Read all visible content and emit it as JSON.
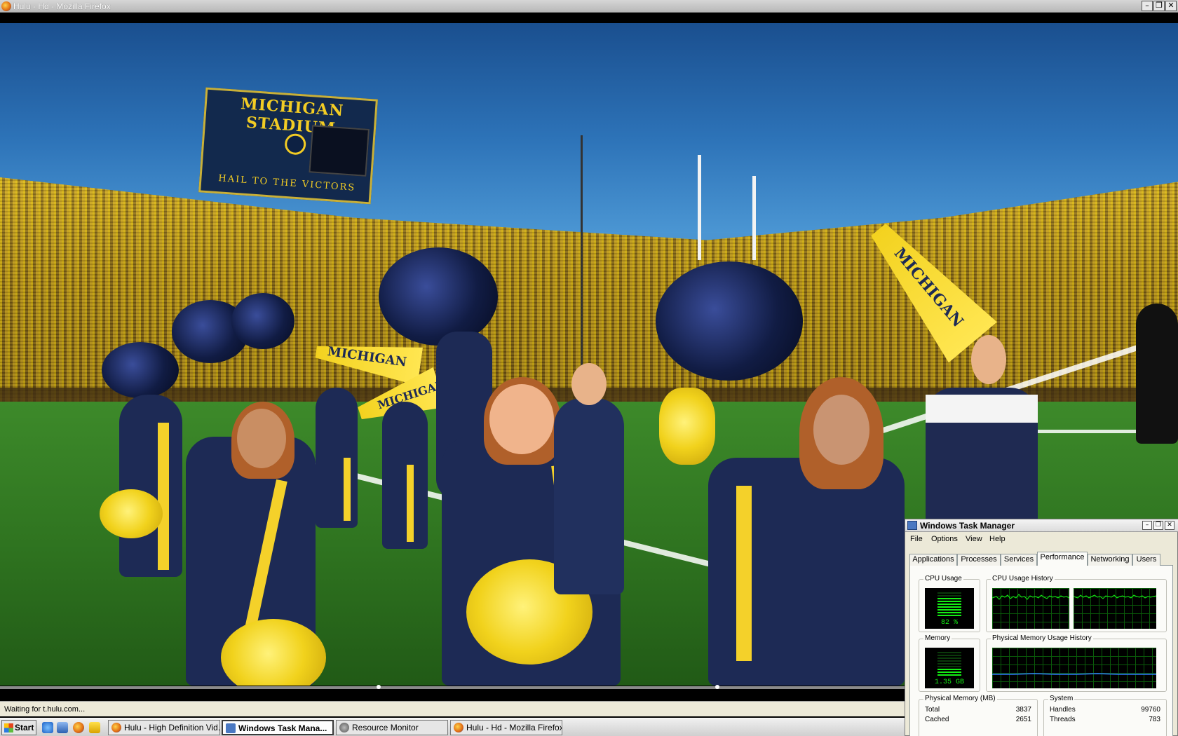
{
  "window": {
    "title": "Hulu - Hd - Mozilla Firefox",
    "controls": [
      "minimize",
      "restore",
      "close"
    ]
  },
  "video": {
    "scoreboard_title": "MICHIGAN STADIUM",
    "scoreboard_footer": "HAIL TO THE VICTORS",
    "megaphone_text": "MICHIGAN",
    "seek_markers": 2
  },
  "statusbar": {
    "text": "Waiting for t.hulu.com..."
  },
  "taskbar": {
    "start_label": "Start",
    "quicklaunch": [
      "internet-explorer-icon",
      "show-desktop-icon",
      "firefox-icon",
      "aim-icon"
    ],
    "tasks": [
      {
        "label": "Hulu - High Definition Vid...",
        "icon": "firefox-icon",
        "active": false
      },
      {
        "label": "Windows Task Mana...",
        "icon": "task-manager-icon",
        "active": true
      },
      {
        "label": "Resource Monitor",
        "icon": "resource-monitor-icon",
        "active": false
      },
      {
        "label": "Hulu - Hd - Mozilla Firefox",
        "icon": "firefox-icon",
        "active": false
      }
    ]
  },
  "taskmgr": {
    "title": "Windows Task Manager",
    "menu": [
      "File",
      "Options",
      "View",
      "Help"
    ],
    "tabs": [
      "Applications",
      "Processes",
      "Services",
      "Performance",
      "Networking",
      "Users"
    ],
    "active_tab": "Performance",
    "cpu_usage": {
      "label": "CPU Usage",
      "value": "82 %",
      "fraction": 0.82
    },
    "cpu_history": {
      "label": "CPU Usage History"
    },
    "memory": {
      "label": "Memory",
      "value": "1.35 GB",
      "fraction": 0.35
    },
    "mem_history": {
      "label": "Physical Memory Usage History"
    },
    "physical_memory": {
      "label": "Physical Memory (MB)",
      "rows": [
        {
          "name": "Total",
          "value": "3837"
        },
        {
          "name": "Cached",
          "value": "2651"
        }
      ]
    },
    "system": {
      "label": "System",
      "rows": [
        {
          "name": "Handles",
          "value": "99760"
        },
        {
          "name": "Threads",
          "value": "783"
        }
      ]
    },
    "colors": {
      "graph_green": "#14f014",
      "graph_grid": "#0a5a0a",
      "mem_line": "#2f7cff"
    }
  }
}
